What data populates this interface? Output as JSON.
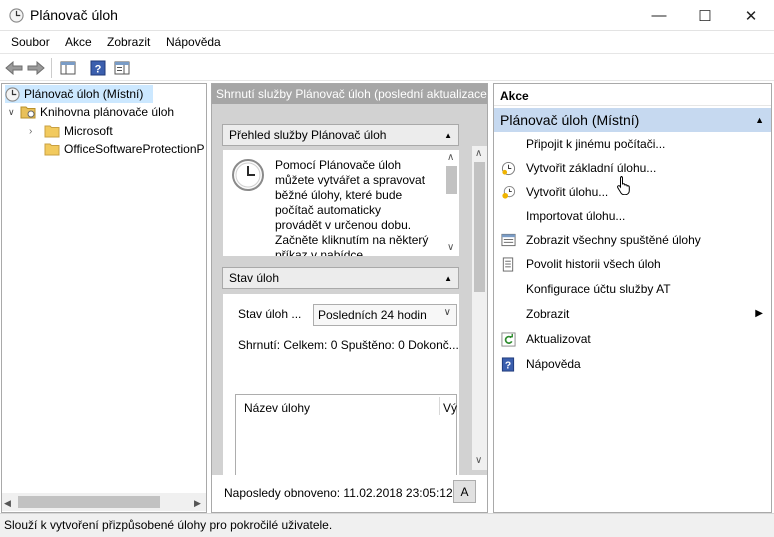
{
  "window": {
    "title": "Plánovač úloh",
    "min": "—",
    "max": "☐",
    "close": "✕"
  },
  "menu": [
    "Soubor",
    "Akce",
    "Zobrazit",
    "Nápověda"
  ],
  "tree": {
    "root": "Plánovač úloh (Místní)",
    "library": "Knihovna plánovače úloh",
    "children": [
      "Microsoft",
      "OfficeSoftwareProtectionP"
    ]
  },
  "center": {
    "header": "Shrnutí služby Plánovač úloh (poslední aktualizace:",
    "overview_title": "Přehled služby Plánovač úloh",
    "overview_text": "Pomocí Plánovače úloh můžete vytvářet a spravovat běžné úlohy, které bude počítač automaticky provádět v určenou dobu. Začněte kliknutím na některý příkaz v nabídce",
    "status_title": "Stav úloh",
    "status_label": "Stav úloh ...",
    "status_select": "Posledních 24 hodin",
    "summary": "Shrnutí: Celkem: 0 Spuštěno: 0 Dokonč...",
    "col_name": "Název úlohy",
    "col_result": "Vý",
    "last_refresh": "Naposledy obnoveno: 11.02.2018 23:05:12",
    "refresh_btn": "A"
  },
  "actions": {
    "header": "Akce",
    "group": "Plánovač úloh (Místní)",
    "items": [
      "Připojit k jinému počítači...",
      "Vytvořit základní úlohu...",
      "Vytvořit úlohu...",
      "Importovat úlohu...",
      "Zobrazit všechny spuštěné úlohy",
      "Povolit historii všech úloh",
      "Konfigurace účtu služby AT",
      "Zobrazit",
      "Aktualizovat",
      "Nápověda"
    ]
  },
  "status": "Slouží k vytvoření přizpůsobené úlohy pro pokročilé uživatele.",
  "colors": {
    "accent": "#0078d7",
    "selection": "#cce8ff",
    "group_header": "#c6d9f0",
    "center_header": "#a6a6a6"
  }
}
